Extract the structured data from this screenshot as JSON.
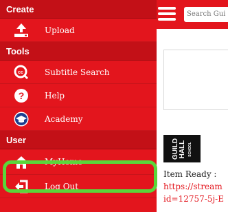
{
  "sidebar": {
    "sections": [
      {
        "title": "Create",
        "items": [
          {
            "label": "Upload",
            "icon": "upload-icon"
          }
        ]
      },
      {
        "title": "Tools",
        "items": [
          {
            "label": "Subtitle Search",
            "icon": "cc-icon"
          },
          {
            "label": "Help",
            "icon": "help-icon"
          },
          {
            "label": "Academy",
            "icon": "academy-icon"
          }
        ]
      },
      {
        "title": "User",
        "items": [
          {
            "label": "MyHome",
            "icon": "home-icon"
          },
          {
            "label": "Log Out",
            "icon": "logout-icon"
          }
        ]
      }
    ]
  },
  "header": {
    "search_placeholder": "Search Gui"
  },
  "content": {
    "logo_text": "GUILD HALL",
    "logo_subtext": "SCHOOL",
    "item_ready": "Item Ready :",
    "link_line1": "https://stream",
    "link_line2": "id=12757-5j-E"
  },
  "colors": {
    "accent": "#e3151d",
    "highlight": "#5ad63a"
  }
}
